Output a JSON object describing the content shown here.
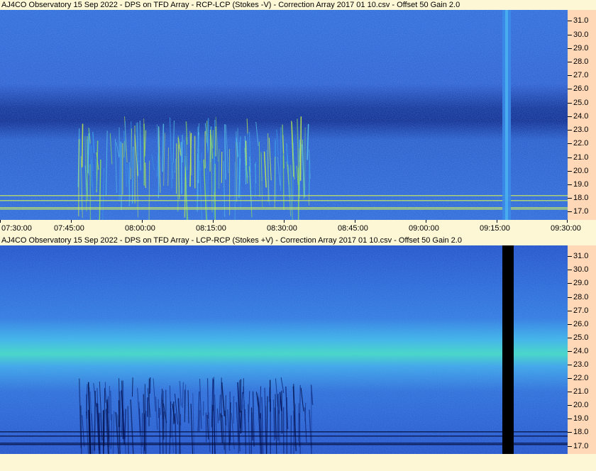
{
  "chart_data": [
    {
      "type": "heatmap",
      "title": "AJ4CO Observatory 15 Sep 2022  -  DPS on TFD Array  -  RCP-LCP (Stokes -V)  -  Correction Array 2017 01 10.csv  -  Offset 50  Gain 2.0",
      "ylabel": "",
      "y_ticks": [
        "31.0",
        "30.0",
        "29.0",
        "28.0",
        "27.0",
        "26.0",
        "25.0",
        "24.0",
        "23.0",
        "22.0",
        "21.0",
        "20.0",
        "19.0",
        "18.0",
        "17.0"
      ],
      "ylim": [
        16.4,
        31.8
      ],
      "x_ticks": [
        "07:30:00",
        "07:45:00",
        "08:00:00",
        "08:15:00",
        "08:30:00",
        "08:45:00",
        "09:00:00",
        "09:15:00",
        "09:30:00"
      ],
      "palette": {
        "low": "#08248a",
        "mid": "#2a70e0",
        "high": "#c8f048"
      }
    },
    {
      "type": "heatmap",
      "title": "AJ4CO Observatory 15 Sep 2022  -  DPS on TFD Array  -  LCP-RCP (Stokes +V)  -  Correction Array 2017 01 10.csv  -  Offset 50  Gain 2.0",
      "ylabel": "",
      "y_ticks": [
        "31.0",
        "30.0",
        "29.0",
        "28.0",
        "27.0",
        "26.0",
        "25.0",
        "24.0",
        "23.0",
        "22.0",
        "21.0",
        "20.0",
        "19.0",
        "18.0",
        "17.0"
      ],
      "ylim": [
        16.4,
        31.8
      ],
      "palette": {
        "low": "#000000",
        "mid": "#2a70e0",
        "high": "#30f0a0"
      }
    }
  ]
}
